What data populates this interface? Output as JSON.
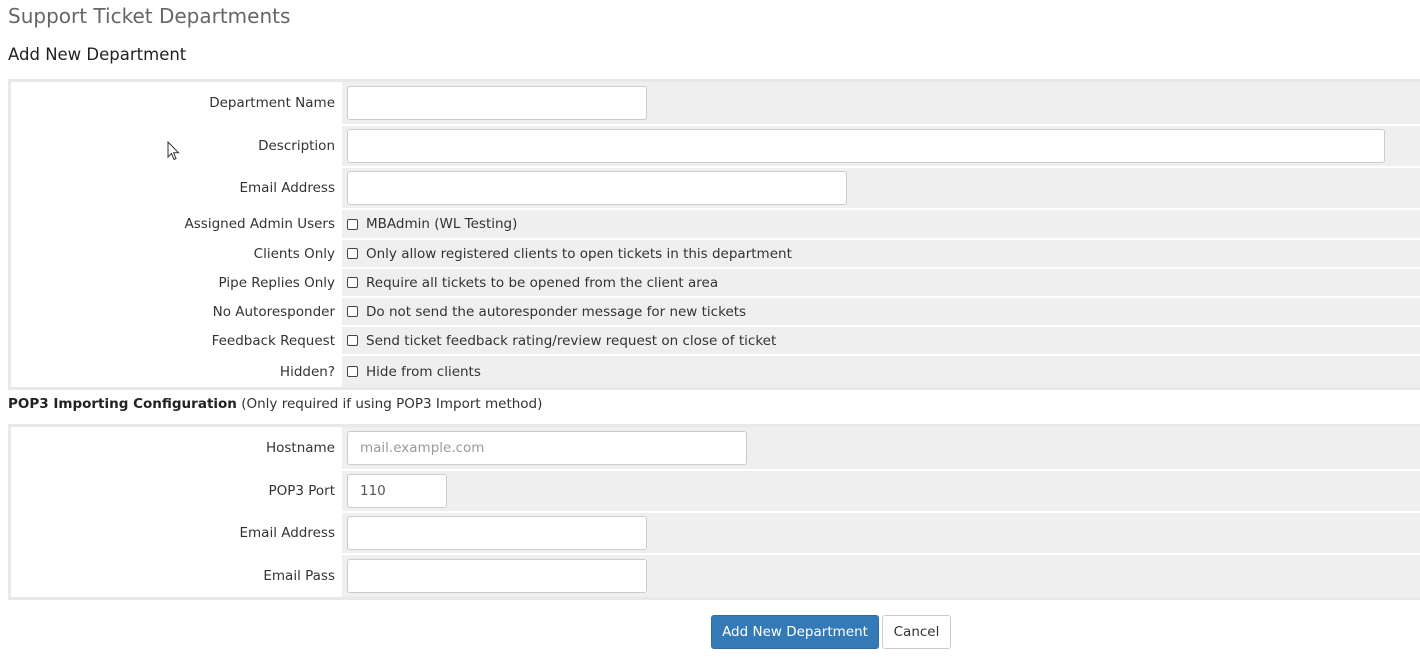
{
  "page": {
    "title": "Support Ticket Departments",
    "section_title": "Add New Department"
  },
  "department_form": {
    "department_name": {
      "label": "Department Name",
      "value": ""
    },
    "description": {
      "label": "Description",
      "value": ""
    },
    "email_address": {
      "label": "Email Address",
      "value": ""
    },
    "assigned_admin_users": {
      "label": "Assigned Admin Users",
      "option": "MBAdmin (WL Testing)",
      "checked": false
    },
    "clients_only": {
      "label": "Clients Only",
      "option": "Only allow registered clients to open tickets in this department",
      "checked": false
    },
    "pipe_replies_only": {
      "label": "Pipe Replies Only",
      "option": "Require all tickets to be opened from the client area",
      "checked": false
    },
    "no_autoresponder": {
      "label": "No Autoresponder",
      "option": "Do not send the autoresponder message for new tickets",
      "checked": false
    },
    "feedback_request": {
      "label": "Feedback Request",
      "option": "Send ticket feedback rating/review request on close of ticket",
      "checked": false
    },
    "hidden": {
      "label": "Hidden?",
      "option": "Hide from clients",
      "checked": false
    }
  },
  "pop3": {
    "heading_bold": "POP3 Importing Configuration",
    "heading_note": " (Only required if using POP3 Import method)",
    "hostname": {
      "label": "Hostname",
      "value": "",
      "placeholder": "mail.example.com"
    },
    "port": {
      "label": "POP3 Port",
      "value": "110"
    },
    "email_address": {
      "label": "Email Address",
      "value": ""
    },
    "email_pass": {
      "label": "Email Pass",
      "value": ""
    }
  },
  "actions": {
    "submit_label": "Add New Department",
    "cancel_label": "Cancel"
  },
  "colors": {
    "primary": "#337ab7",
    "field_background": "#efefef",
    "table_border": "#e8e8e8"
  }
}
